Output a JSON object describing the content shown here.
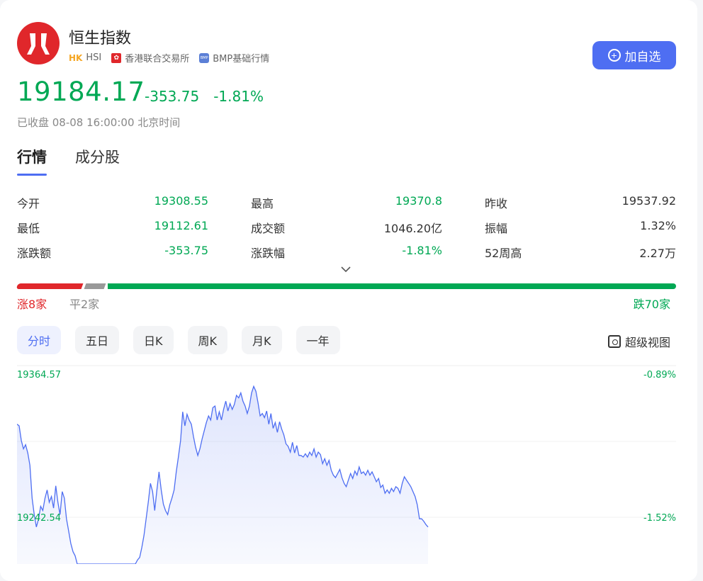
{
  "header": {
    "title": "恒生指数",
    "market_tag": "HK",
    "code": "HSI",
    "exchange": "香港联合交易所",
    "data_source": "BMP基础行情",
    "add_button": "加自选"
  },
  "quote": {
    "price": "19184.17",
    "change": "-353.75",
    "change_pct": "-1.81%",
    "status": "已收盘 08-08 16:00:00 北京时间"
  },
  "tabs": [
    "行情",
    "成分股"
  ],
  "stats": [
    [
      {
        "label": "今开",
        "value": "19308.55"
      },
      {
        "label": "最高",
        "value": "19370.8"
      },
      {
        "label": "昨收",
        "value": "19537.92"
      }
    ],
    [
      {
        "label": "最低",
        "value": "19112.61"
      },
      {
        "label": "成交额",
        "value": "1046.20亿"
      },
      {
        "label": "振幅",
        "value": "1.32%"
      }
    ],
    [
      {
        "label": "涨跌额",
        "value": "-353.75"
      },
      {
        "label": "涨跌幅",
        "value": "-1.81%"
      },
      {
        "label": "52周高",
        "value": "2.27万"
      }
    ]
  ],
  "breadth": {
    "up_label": "涨8家",
    "flat_label": "平2家",
    "down_label": "跌70家",
    "up": 8,
    "flat": 2,
    "down": 70
  },
  "periods": [
    "分时",
    "五日",
    "日K",
    "周K",
    "月K",
    "一年"
  ],
  "super_view": "超级视图",
  "colors": {
    "up": "#e0272b",
    "down": "#00a854",
    "accent": "#4e6ef2"
  },
  "chart_data": {
    "type": "area",
    "y_left_labels": [
      "19364.57",
      "19242.54"
    ],
    "y_right_labels": [
      "-0.89%",
      "-1.52%"
    ],
    "ylim": [
      19150,
      19380
    ],
    "grid": true,
    "values": [
      19320,
      19318,
      19300,
      19290,
      19295,
      19285,
      19270,
      19230,
      19210,
      19195,
      19205,
      19220,
      19215,
      19230,
      19240,
      19225,
      19232,
      19218,
      19245,
      19225,
      19210,
      19238,
      19230,
      19205,
      19190,
      19175,
      19165,
      19160,
      19150,
      19150,
      19150,
      19150,
      19150,
      19150,
      19150,
      19150,
      19150,
      19150,
      19150,
      19150,
      19150,
      19150,
      19150,
      19150,
      19150,
      19150,
      19150,
      19150,
      19150,
      19150,
      19150,
      19150,
      19150,
      19150,
      19150,
      19150,
      19155,
      19158,
      19170,
      19185,
      19205,
      19225,
      19248,
      19238,
      19215,
      19240,
      19262,
      19240,
      19223,
      19215,
      19210,
      19222,
      19230,
      19240,
      19262,
      19280,
      19300,
      19335,
      19318,
      19332,
      19325,
      19320,
      19305,
      19292,
      19282,
      19290,
      19302,
      19312,
      19322,
      19330,
      19325,
      19340,
      19342,
      19325,
      19335,
      19325,
      19338,
      19348,
      19336,
      19345,
      19338,
      19344,
      19355,
      19352,
      19358,
      19348,
      19342,
      19333,
      19342,
      19358,
      19366,
      19360,
      19346,
      19330,
      19333,
      19328,
      19336,
      19320,
      19333,
      19315,
      19322,
      19310,
      19323,
      19314,
      19307,
      19296,
      19293,
      19286,
      19298,
      19285,
      19294,
      19282,
      19282,
      19280,
      19284,
      19280,
      19286,
      19282,
      19290,
      19280,
      19286,
      19283,
      19272,
      19278,
      19270,
      19276,
      19264,
      19258,
      19255,
      19260,
      19265,
      19255,
      19248,
      19244,
      19252,
      19260,
      19254,
      19263,
      19258,
      19268,
      19260,
      19262,
      19258,
      19264,
      19258,
      19262,
      19256,
      19250,
      19254,
      19243,
      19246,
      19236,
      19240,
      19236,
      19242,
      19238,
      19244,
      19242,
      19236,
      19248,
      19256,
      19252,
      19248,
      19244,
      19238,
      19232,
      19222,
      19205,
      19205,
      19202,
      19198,
      19195
    ]
  }
}
